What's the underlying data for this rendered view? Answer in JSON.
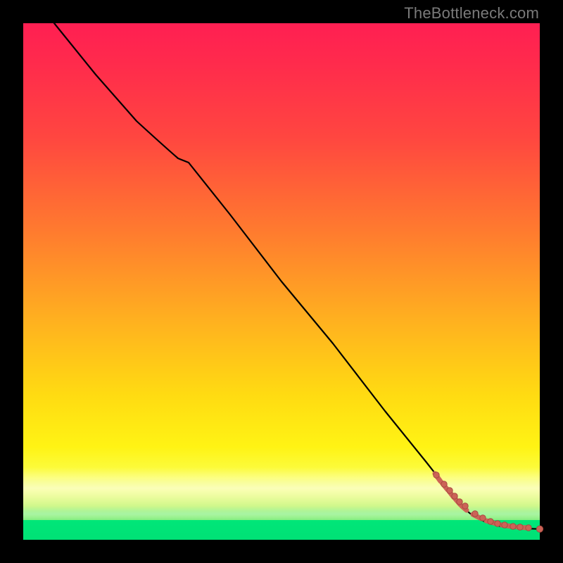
{
  "attribution": "TheBottleneck.com",
  "colors": {
    "frame_background": "#000000",
    "gradient_top": "#ff1f52",
    "gradient_mid": "#fff314",
    "gradient_bottom": "#22e28a",
    "curve": "#000000",
    "marker": "#cc6357",
    "attribution_text": "#7a7a7a"
  },
  "chart_data": {
    "type": "line",
    "title": "",
    "xlabel": "",
    "ylabel": "",
    "xlim": [
      0,
      100
    ],
    "ylim": [
      0,
      100
    ],
    "note": "No axes, ticks, or legend are rendered. Values estimated from pixel positions; y is inverted (0 at top of plot, 100 at bottom).",
    "series": [
      {
        "name": "curve",
        "style": "line",
        "x": [
          6,
          14,
          22,
          28,
          32,
          40,
          50,
          60,
          70,
          78,
          82,
          85,
          88,
          91,
          94,
          97,
          100
        ],
        "y": [
          0,
          10,
          19,
          23,
          27,
          37,
          50,
          62,
          75,
          85,
          90,
          93.5,
          95.3,
          96.5,
          97.2,
          97.6,
          97.9
        ]
      },
      {
        "name": "markers",
        "style": "points",
        "x": [
          80,
          81.5,
          82.5,
          83.5,
          84.5,
          85.5,
          87.5,
          89,
          90.5,
          91.8,
          93.2,
          94.8,
          96.2,
          97.8,
          100
        ],
        "y": [
          87.5,
          89.2,
          90.5,
          91.6,
          92.6,
          93.5,
          95,
          95.8,
          96.4,
          96.9,
          97.2,
          97.4,
          97.6,
          97.7,
          97.9
        ]
      }
    ]
  }
}
